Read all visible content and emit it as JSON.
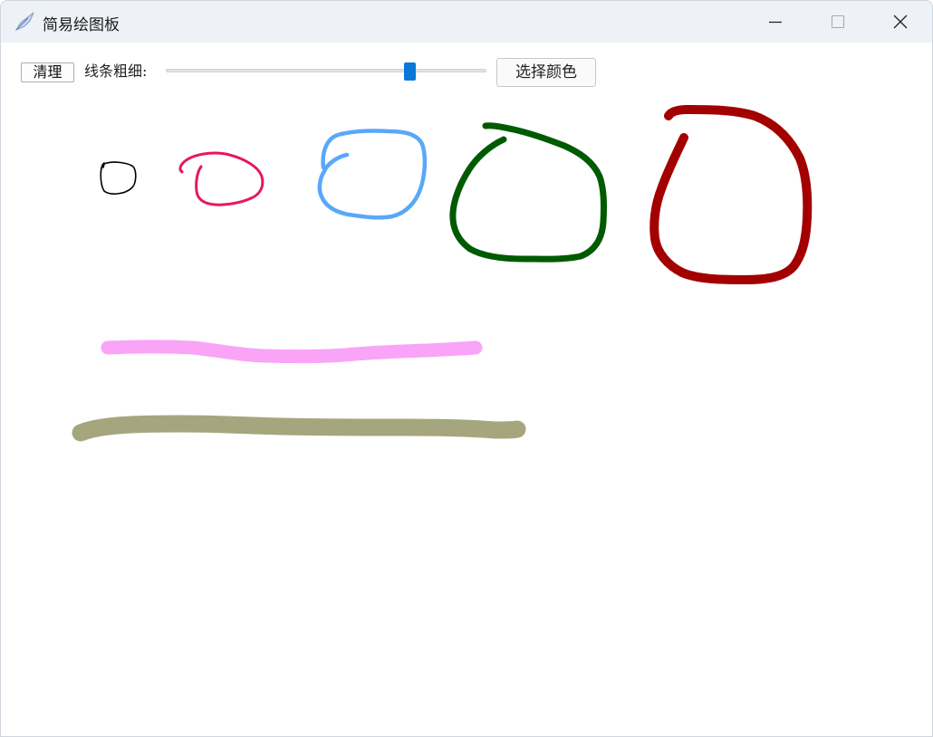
{
  "window": {
    "title": "简易绘图板"
  },
  "toolbar": {
    "clear_label": "清理",
    "line_width_label": "线条粗细:",
    "line_width_level": 0.77,
    "choose_color_label": "选择颜色"
  },
  "canvas": {
    "strokes": [
      {
        "name": "black-circle-stroke",
        "color": "#000000"
      },
      {
        "name": "red-circle-stroke",
        "color": "#e8175d"
      },
      {
        "name": "blue-circle-stroke",
        "color": "#59a8f8"
      },
      {
        "name": "green-circle-stroke",
        "color": "#005a00"
      },
      {
        "name": "darkred-circle-stroke",
        "color": "#a30000"
      },
      {
        "name": "pink-line-stroke",
        "color": "#f9a4f6"
      },
      {
        "name": "olive-line-stroke",
        "color": "#a6a67e"
      }
    ]
  },
  "icons": {
    "app": "app-feather-icon",
    "minimize": "minimize-icon",
    "maximize": "maximize-icon",
    "close": "close-icon"
  }
}
